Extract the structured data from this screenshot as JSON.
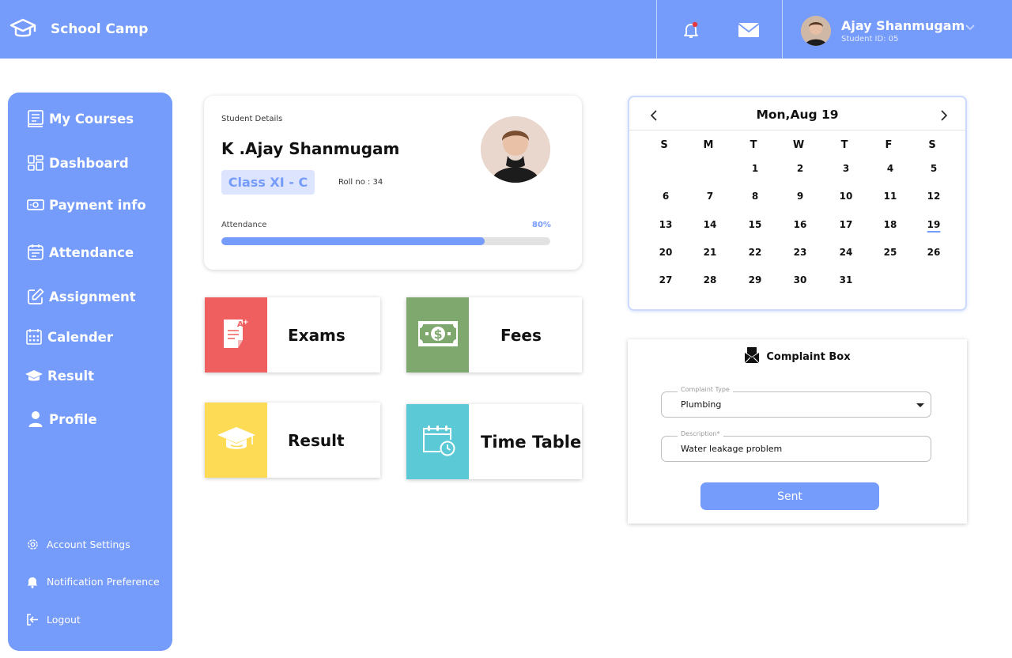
{
  "app": {
    "title": "School Camp"
  },
  "user": {
    "name": "Ajay Shanmugam",
    "student_id": "Student ID: 05"
  },
  "sidebar": {
    "items": [
      {
        "label": "My Courses",
        "icon": "book-icon"
      },
      {
        "label": "Dashboard",
        "icon": "dashboard-icon"
      },
      {
        "label": "Payment info",
        "icon": "payment-icon"
      },
      {
        "label": "Attendance",
        "icon": "attendance-icon"
      },
      {
        "label": "Assignment",
        "icon": "edit-icon"
      },
      {
        "label": "Calender",
        "icon": "calendar-icon"
      },
      {
        "label": "Result",
        "icon": "graduation-cap-icon"
      },
      {
        "label": "Profile",
        "icon": "user-icon"
      }
    ],
    "bottom": [
      {
        "label": "Account Settings",
        "icon": "gear-icon"
      },
      {
        "label": "Notification Preference",
        "icon": "bell-icon"
      },
      {
        "label": "Logout",
        "icon": "logout-icon"
      }
    ]
  },
  "student": {
    "section_label": "Student Details",
    "name": "K .Ajay Shanmugam",
    "class": "Class XI - C",
    "roll": "Roll no : 34",
    "attendance_label": "Attendance",
    "attendance_pct": "80%",
    "attendance_fraction": 0.8
  },
  "tiles": [
    {
      "label": "Exams",
      "color": "#f05f5f"
    },
    {
      "label": "Fees",
      "color": "#7fa86f"
    },
    {
      "label": "Result",
      "color": "#fddb55"
    },
    {
      "label": "Time Table",
      "color": "#5ccad6"
    }
  ],
  "calendar": {
    "title": "Mon,Aug 19",
    "weekdays": [
      "S",
      "M",
      "T",
      "W",
      "T",
      "F",
      "S"
    ],
    "days": [
      1,
      2,
      3,
      4,
      5,
      6,
      7,
      8,
      9,
      10,
      11,
      12,
      13,
      14,
      15,
      16,
      17,
      18,
      19,
      20,
      21,
      22,
      23,
      24,
      25,
      26,
      27,
      28,
      29,
      30,
      31
    ],
    "selected": 19
  },
  "complaint": {
    "title": "Complaint Box",
    "type_label": "Complaint Type",
    "type_value": "Plumbing",
    "desc_label": "Description*",
    "desc_value": "Water leakage problem",
    "button": "Sent"
  },
  "colors": {
    "accent": "#759bfb",
    "badge_bg": "#dce5fd"
  }
}
